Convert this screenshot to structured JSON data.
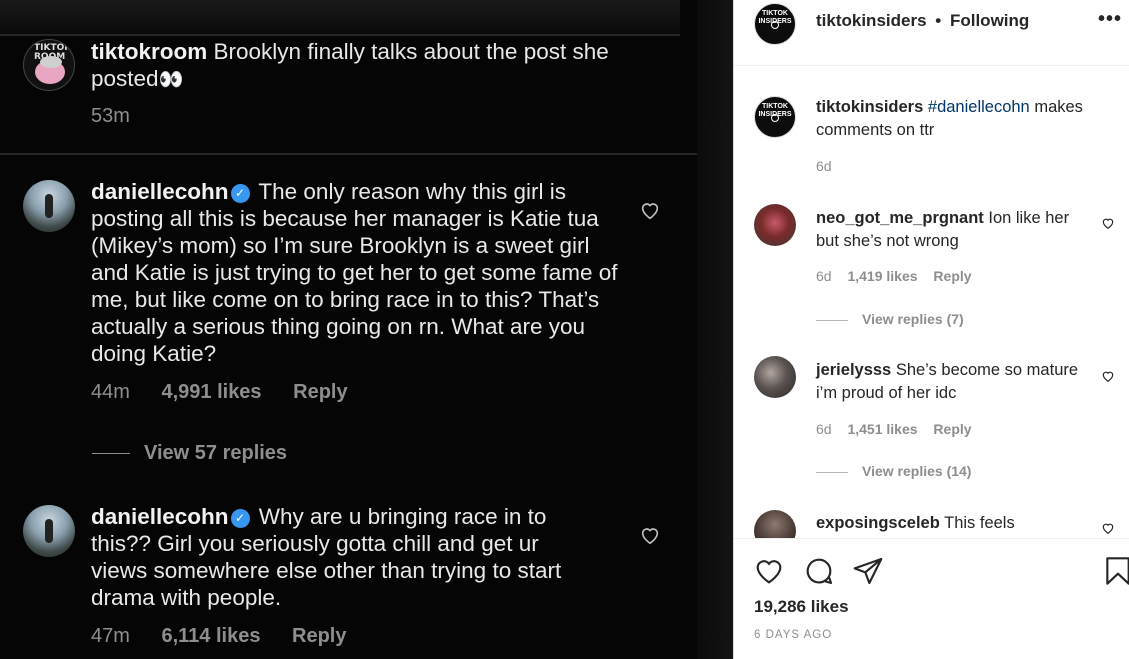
{
  "photo": {
    "comments": [
      {
        "username": "tiktokroom",
        "text": "Brooklyn finally talks about the post she posted",
        "emoji": "👀",
        "time": "53m",
        "avatar_text": "TIKTOK ROOM"
      },
      {
        "username": "daniellecohn",
        "verified": true,
        "text": "The only reason why this girl is posting all this is because her manager is Katie tua (Mikey’s mom) so I’m sure Brooklyn is a sweet girl and Katie is just trying to get her to get some fame of me, but like come on to bring race in to this? That’s actually a serious thing going on rn. What are you doing Katie?",
        "time": "44m",
        "likes": "4,991 likes",
        "reply": "Reply",
        "view_replies": "View 57 replies"
      },
      {
        "username": "daniellecohn",
        "verified": true,
        "text": "Why are u bringing race in to this?? Girl you seriously gotta chill and get ur views somewhere else other than trying to start drama with people.",
        "time": "47m",
        "likes": "6,114 likes",
        "reply": "Reply"
      }
    ]
  },
  "post": {
    "header": {
      "username": "tiktokinsiders",
      "bullet": "•",
      "follow_status": "Following",
      "more_icon": "more-dots-icon",
      "avatar_text": "TIKTOK INSIDERS"
    },
    "caption": {
      "username": "tiktokinsiders",
      "hashtag": "#daniellecohn",
      "text": "makes comments on ttr",
      "time": "6d"
    },
    "comments": [
      {
        "username": "neo_got_me_prgnant",
        "text": "Ion like her but she’s not wrong",
        "time": "6d",
        "likes": "1,419 likes",
        "reply": "Reply",
        "view_replies": "View replies (7)"
      },
      {
        "username": "jerielysss",
        "text": "She’s become so mature i’m proud of her idc",
        "time": "6d",
        "likes": "1,451 likes",
        "reply": "Reply",
        "view_replies": "View replies (14)"
      },
      {
        "username": "exposingsceleb",
        "text": "This feels"
      }
    ],
    "actions": {
      "like_icon": "heart-icon",
      "comment_icon": "comment-icon",
      "share_icon": "share-icon",
      "save_icon": "bookmark-icon"
    },
    "likes": "19,286 likes",
    "posted_ago": "6 DAYS AGO"
  },
  "colors": {
    "link": "#00376b",
    "verified": "#3897f0",
    "muted": "#8e8e8e"
  }
}
